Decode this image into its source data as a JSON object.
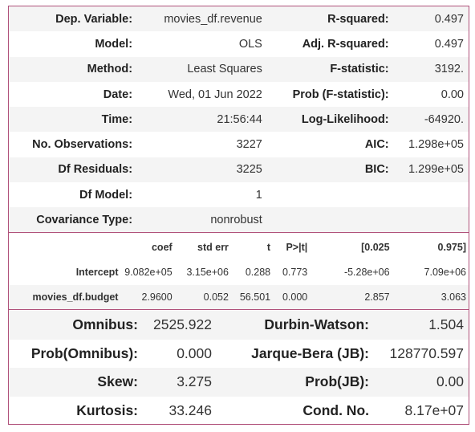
{
  "summary_top": {
    "rows": [
      {
        "l1": "Dep. Variable:",
        "v1": "movies_df.revenue",
        "l2": "R-squared:",
        "v2": "0.497"
      },
      {
        "l1": "Model:",
        "v1": "OLS",
        "l2": "Adj. R-squared:",
        "v2": "0.497"
      },
      {
        "l1": "Method:",
        "v1": "Least Squares",
        "l2": "F-statistic:",
        "v2": "3192."
      },
      {
        "l1": "Date:",
        "v1": "Wed, 01 Jun 2022",
        "l2": "Prob (F-statistic):",
        "v2": "0.00"
      },
      {
        "l1": "Time:",
        "v1": "21:56:44",
        "l2": "Log-Likelihood:",
        "v2": "-64920."
      },
      {
        "l1": "No. Observations:",
        "v1": "3227",
        "l2": "AIC:",
        "v2": "1.298e+05"
      },
      {
        "l1": "Df Residuals:",
        "v1": "3225",
        "l2": "BIC:",
        "v2": "1.299e+05"
      },
      {
        "l1": "Df Model:",
        "v1": "1",
        "l2": "",
        "v2": ""
      },
      {
        "l1": "Covariance Type:",
        "v1": "nonrobust",
        "l2": "",
        "v2": ""
      }
    ]
  },
  "coef_table": {
    "headers": [
      "",
      "coef",
      "std err",
      "t",
      "P>|t|",
      "[0.025",
      "0.975]"
    ],
    "rows": [
      [
        "Intercept",
        "9.082e+05",
        "3.15e+06",
        "0.288",
        "0.773",
        "-5.28e+06",
        "7.09e+06"
      ],
      [
        "movies_df.budget",
        "2.9600",
        "0.052",
        "56.501",
        "0.000",
        "2.857",
        "3.063"
      ]
    ]
  },
  "diagnostics": {
    "rows": [
      {
        "l1": "Omnibus:",
        "v1": "2525.922",
        "l2": "Durbin-Watson:",
        "v2": "1.504"
      },
      {
        "l1": "Prob(Omnibus):",
        "v1": "0.000",
        "l2": "Jarque-Bera (JB):",
        "v2": "128770.597"
      },
      {
        "l1": "Skew:",
        "v1": "3.275",
        "l2": "Prob(JB):",
        "v2": "0.00"
      },
      {
        "l1": "Kurtosis:",
        "v1": "33.246",
        "l2": "Cond. No.",
        "v2": "8.17e+07"
      }
    ]
  },
  "colors": {
    "border": "#b0517a",
    "stripe": "#f4f4f4"
  }
}
